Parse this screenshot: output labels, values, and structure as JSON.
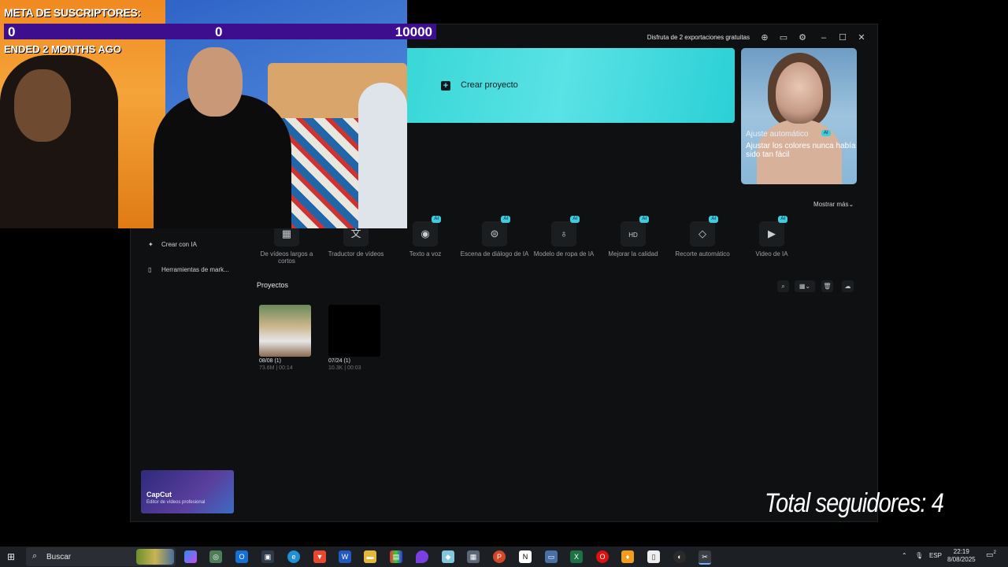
{
  "window": {
    "promo_text": "Disfruta de 2 exportaciones gratuitas",
    "create_project": "Crear proyecto",
    "feature": {
      "title": "Ajuste automático",
      "badge": "AI",
      "description": "Ajustar los colores nunca había sido tan fácil"
    },
    "show_more": "Mostrar más",
    "show_more_icon": "chevron-down-icon",
    "tools": [
      {
        "label": "De vídeos largos a cortos",
        "icon": "film-icon",
        "ai": ""
      },
      {
        "label": "Traductor de vídeos",
        "icon": "translate-icon",
        "ai": ""
      },
      {
        "label": "Texto a voz",
        "icon": "voice-icon",
        "ai": "AI"
      },
      {
        "label": "Escena de diálogo de IA",
        "icon": "dialog-icon",
        "ai": "AI"
      },
      {
        "label": "Modelo de ropa de IA",
        "icon": "shirt-icon",
        "ai": "AI"
      },
      {
        "label": "Mejorar la calidad",
        "icon": "hd-icon",
        "ai": "AI"
      },
      {
        "label": "Recorte automático",
        "icon": "eraser-icon",
        "ai": "AI"
      },
      {
        "label": "Video de IA",
        "icon": "video-icon",
        "ai": "AI"
      }
    ],
    "sidebar": [
      {
        "label": "Crear con IA",
        "icon": "sparkle-icon"
      },
      {
        "label": "Herramientas de mark...",
        "icon": "marketing-icon"
      }
    ],
    "projects_title": "Proyectos",
    "projects": [
      {
        "name": "08/08 (1)",
        "meta": "73.6M | 00:14"
      },
      {
        "name": "07/24 (1)",
        "meta": "10.3K | 00:03"
      }
    ],
    "promo_card": {
      "title": "CapCut",
      "subtitle": "Editor de vídeos profesional"
    }
  },
  "overlay": {
    "meta_title": "META DE SUSCRIPTORES:",
    "bar_left": "0",
    "bar_mid": "0",
    "bar_right": "10000",
    "ended": "ENDED 2 MONTHS AGO",
    "followers": "Total seguidores: 4"
  },
  "taskbar": {
    "search": "Buscar",
    "lang": "ESP",
    "time": "22:19",
    "date": "8/08/2025",
    "notif": "2"
  },
  "colors": {
    "accent": "#3ecde0",
    "bar": "#3d0e8e",
    "bg": "#0e1012"
  }
}
